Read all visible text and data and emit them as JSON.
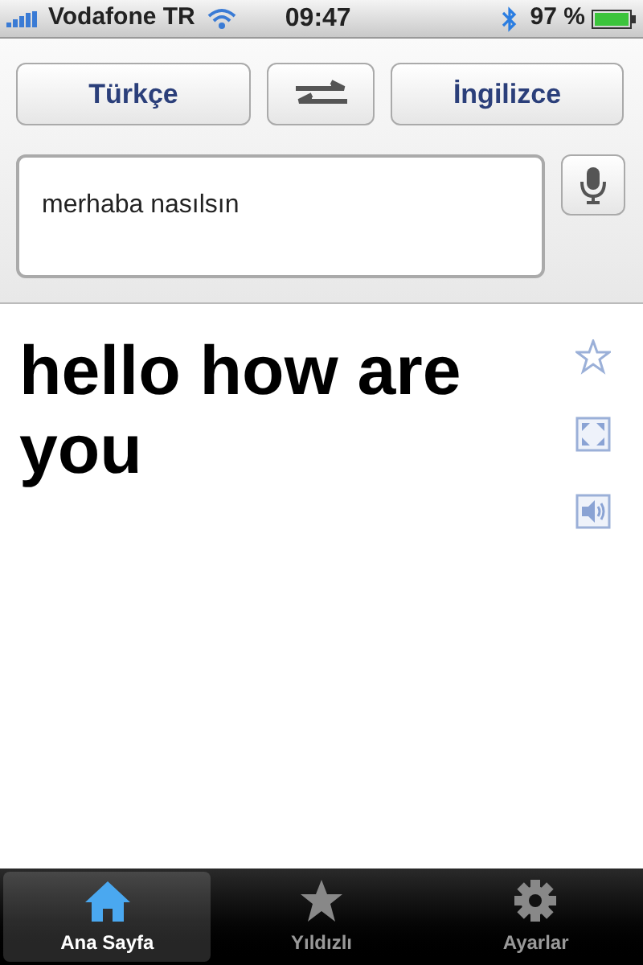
{
  "status_bar": {
    "carrier": "Vodafone TR",
    "time": "09:47",
    "battery": "97 %"
  },
  "languages": {
    "source": "Türkçe",
    "target": "İngilizce"
  },
  "input": {
    "value": "merhaba nasılsın"
  },
  "translation": "hello how are you",
  "tabs": [
    {
      "label": "Ana Sayfa",
      "kind": "home",
      "selected": true
    },
    {
      "label": "Yıldızlı",
      "kind": "star",
      "selected": false
    },
    {
      "label": "Ayarlar",
      "kind": "gear",
      "selected": false
    }
  ]
}
